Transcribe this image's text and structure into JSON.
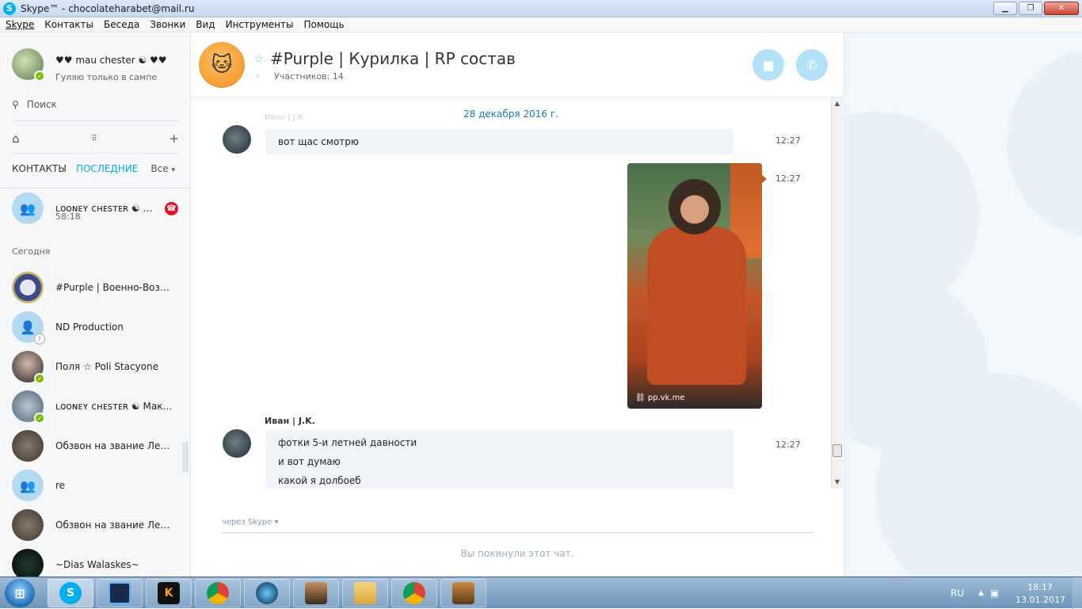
{
  "window": {
    "title": "Skype™ - chocolateharabet@mail.ru",
    "minimize": "▁",
    "maximize": "❐",
    "close": "✕"
  },
  "menu": [
    "Skype",
    "Контакты",
    "Беседа",
    "Звонки",
    "Вид",
    "Инструменты",
    "Помощь"
  ],
  "profile": {
    "name": "♥♥ mau chester ☯ ♥♥",
    "mood": "Гуляю только в сампе"
  },
  "search": {
    "label": "Поиск"
  },
  "tabs": {
    "contacts": "КОНТАКТЫ",
    "recent": "ПОСЛЕДНИЕ",
    "filter": "Все"
  },
  "active_call": {
    "name": "ʟᴏᴏɴᴇʏ ᴄʜᴇꜱᴛᴇʀ ☯ Ма...",
    "duration": "58:18"
  },
  "section_today": "Сегодня",
  "contacts": [
    {
      "name": "#Purple | Военно-Возд..."
    },
    {
      "name": "ND Production"
    },
    {
      "name": "Поля ☆ Poli Stacyone"
    },
    {
      "name": "ʟᴏᴏɴᴇʏ ᴄʜᴇꜱᴛᴇʀ ☯ Макс..."
    },
    {
      "name": "Обзвон на звание Лей..."
    },
    {
      "name": "re"
    },
    {
      "name": "Обзвон на звание Лей..."
    },
    {
      "name": "~Dias Walaskes~"
    }
  ],
  "chat": {
    "title": "#Purple | Курилка | RP состав",
    "members": "Участников: 14",
    "date": "28 декабря 2016 г.",
    "ghost_sender": "Иван | J.K.",
    "messages": [
      {
        "lines": [
          "вот щас смотрю"
        ],
        "time": "12:27"
      },
      {
        "photo_link": "pp.vk.me",
        "time": "12:27"
      },
      {
        "sender": "Иван | J.K.",
        "lines": [
          "фотки 5-и летней давности",
          "и вот думаю",
          "какой я долбоеб"
        ],
        "time": "12:27"
      }
    ],
    "via": "через Skype ▾",
    "left_notice": "Вы покинули этот чат."
  },
  "taskbar": {
    "lang": "RU",
    "time": "18:17",
    "date": "13.01.2017"
  },
  "colors": {
    "accent": "#00aff0",
    "online": "#7fba00",
    "hangup": "#e81123"
  }
}
